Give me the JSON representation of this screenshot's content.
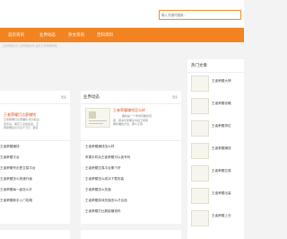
{
  "search": {
    "placeholder": "输入关键词搜索..."
  },
  "nav": {
    "items": [
      "首页资讯",
      "业界动态",
      "热文资讯",
      "百科资料"
    ]
  },
  "breadcrumb": "王者荣耀资讯 王者荣耀资讯 最新王者荣耀攻略",
  "left_panel": {
    "more": "更多",
    "feature_title": "王者荣耀打比赛赚钱",
    "feature_lines": [
      "王者荣耀打比赛赚钱 成为职业",
      "选手后，每月工资加奖金，王",
      "者荣耀最高可达千万元...更多"
    ],
    "items": [
      "王者荣耀赚钱",
      "王者荣耀平台",
      "王者荣耀号出售交易平台",
      "王者荣耀怎么快速升级",
      "王者荣耀每一级怎么升",
      "王者荣耀新手入门攻略"
    ]
  },
  "middle_panel": {
    "title": "业界动态",
    "more": "更多",
    "feature_title": "王者荣耀赚钱怎么样",
    "feature_lines": [
      "赚钱是一个非常有趣的话",
      "题，很多玩家都在寻找王者荣",
      "耀的赚钱方法，那么王者..."
    ],
    "items": [
      "王者荣耀赚钱怎么样",
      "苹果手机玩王者荣耀可以卖号吗",
      "王者荣耀交易平台哪个好",
      "王者荣耀怎么成功下载安装",
      "王者荣耀怎么充值",
      "王者荣耀游戏充值怎么才合适",
      "王者荣耀打比赛能赚钱吗"
    ]
  },
  "hot": {
    "title": "热门文章",
    "items": [
      "王者荣耀大神",
      "王者荣耀攻略",
      "王者荣耀排位",
      "王者荣耀赚钱",
      "王者荣耀交易",
      "王者荣耀出装",
      "王者荣耀上分"
    ]
  }
}
